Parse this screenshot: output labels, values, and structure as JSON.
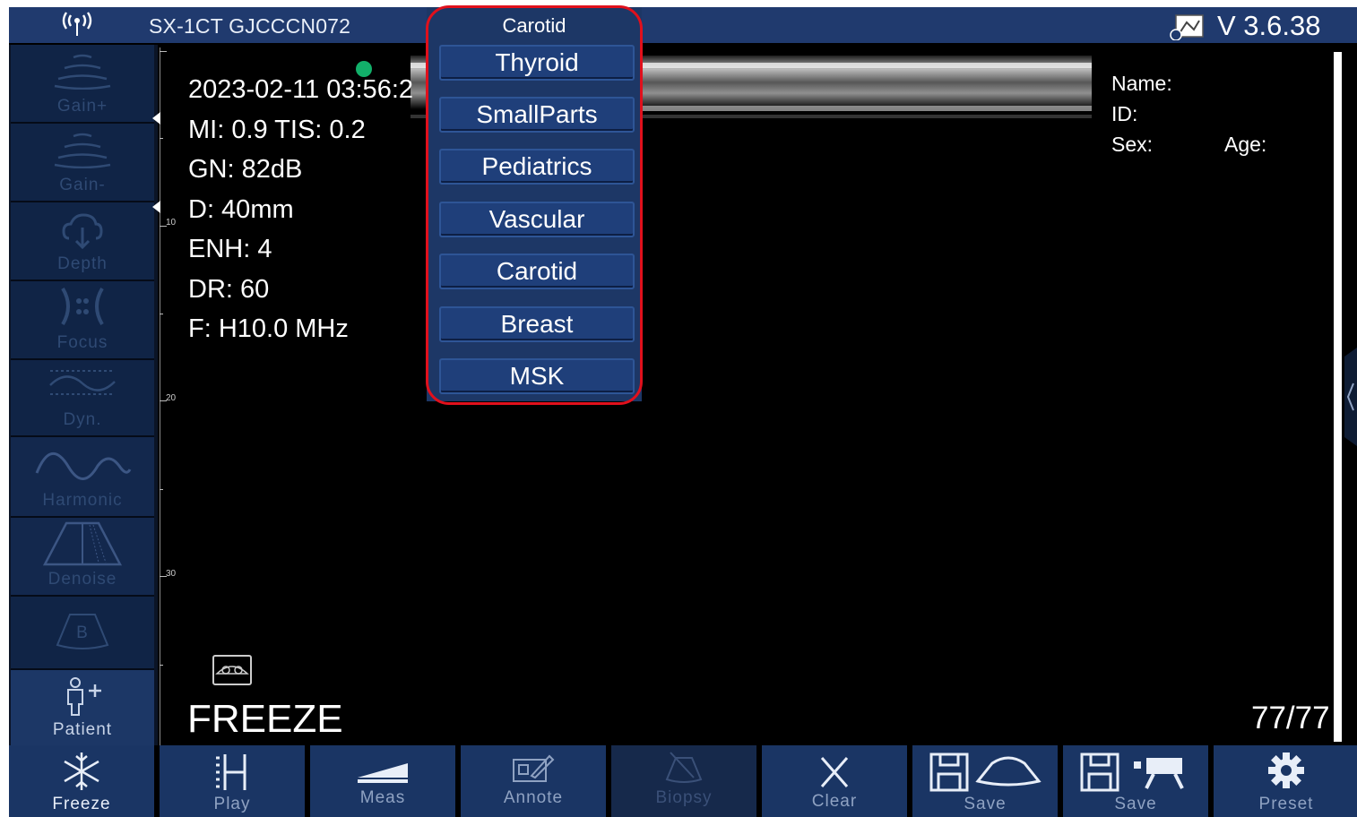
{
  "topbar": {
    "device": "SX-1CT GJCCCN072",
    "version": "V 3.6.38"
  },
  "sidebar": {
    "items": [
      {
        "label": "Gain+",
        "icon": "gain-up-icon"
      },
      {
        "label": "Gain-",
        "icon": "gain-down-icon"
      },
      {
        "label": "Depth",
        "icon": "depth-icon"
      },
      {
        "label": "Focus",
        "icon": "focus-icon"
      },
      {
        "label": "Dyn.",
        "icon": "dynamic-range-icon"
      },
      {
        "label": "Harmonic",
        "icon": "harmonic-icon"
      },
      {
        "label": "Denoise",
        "icon": "denoise-icon"
      },
      {
        "label": "B",
        "icon": "b-mode-icon"
      },
      {
        "label": "Patient",
        "icon": "patient-icon"
      }
    ]
  },
  "scale": {
    "labels": [
      "10",
      "20",
      "30"
    ]
  },
  "params": {
    "datetime": "2023-02-11 03:56:2",
    "mi_tis": "MI: 0.9  TIS: 0.2",
    "gain": "GN: 82dB",
    "depth": "D: 40mm",
    "enh": "ENH: 4",
    "dr": "DR: 60",
    "freq": "F: H10.0 MHz"
  },
  "patient": {
    "name": "Name:",
    "id": "ID:",
    "sex": "Sex:",
    "age": "Age:"
  },
  "status": {
    "freeze": "FREEZE",
    "frame_counter": "77/77"
  },
  "preset_menu": {
    "title": "Carotid",
    "items": [
      "Thyroid",
      "SmallParts",
      "Pediatrics",
      "Vascular",
      "Carotid",
      "Breast",
      "MSK"
    ]
  },
  "toolbar": {
    "items": [
      {
        "label": "Freeze",
        "icon": "snowflake-icon"
      },
      {
        "label": "Play",
        "icon": "play-cine-icon"
      },
      {
        "label": "Meas",
        "icon": "measure-icon"
      },
      {
        "label": "Annote",
        "icon": "annotate-icon"
      },
      {
        "label": "Biopsy",
        "icon": "biopsy-icon"
      },
      {
        "label": "Clear",
        "icon": "clear-icon"
      },
      {
        "label": "Save",
        "icon": "save-image-icon"
      },
      {
        "label": "Save",
        "icon": "save-video-icon"
      },
      {
        "label": "Preset",
        "icon": "gear-icon"
      }
    ]
  },
  "colors": {
    "panel": "#203a6e",
    "button": "#1a3564",
    "highlight": "#e0101c",
    "probe_dot": "#12b06a"
  }
}
